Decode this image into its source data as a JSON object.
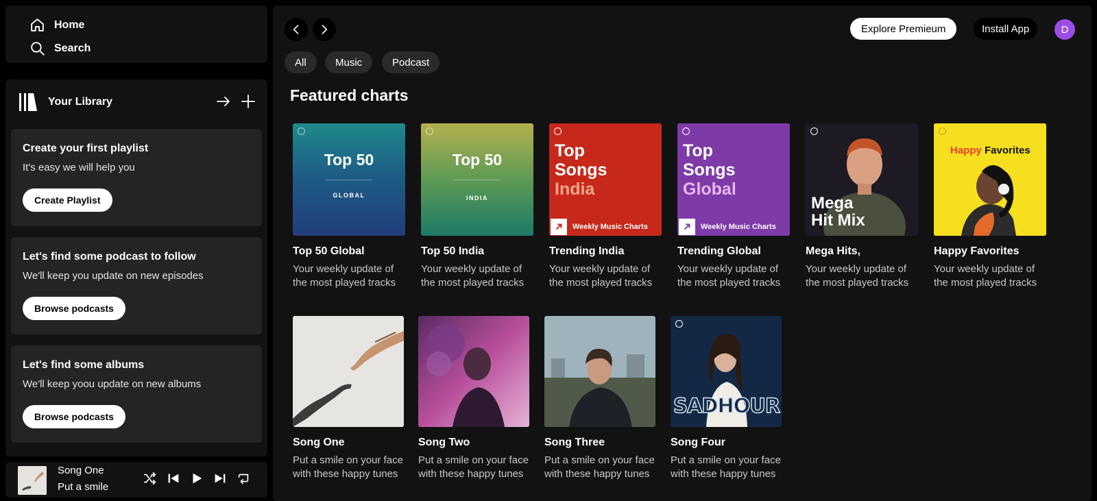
{
  "nav": {
    "home": "Home",
    "search": "Search"
  },
  "library": {
    "title": "Your Library",
    "cards": [
      {
        "title": "Create your first playlist",
        "subtitle": "It's easy we will help you",
        "button": "Create Playlist"
      },
      {
        "title": "Let's find some podcast to follow",
        "subtitle": "We'll keep you update on new episodes",
        "button": "Browse podcasts"
      },
      {
        "title": "Let's find some albums",
        "subtitle": "We'll keep yoou update on new albums",
        "button": "Browse podcasts"
      }
    ]
  },
  "player": {
    "title": "Song One",
    "subtitle": "Put a smile"
  },
  "header": {
    "premium": "Explore Premieum",
    "install": "Install App",
    "avatar": "D"
  },
  "filters": [
    "All",
    "Music",
    "Podcast"
  ],
  "section_title": "Featured charts",
  "charts": [
    {
      "title": "Top 50 Global",
      "subtitle": "Your weekly update of the most played tracks",
      "cover_big": "Top 50",
      "cover_small": "GLOBAL"
    },
    {
      "title": "Top 50 India",
      "subtitle": "Your weekly update of the most played tracks",
      "cover_big": "Top 50",
      "cover_small": "INDIA"
    },
    {
      "title": "Trending India",
      "subtitle": "Your weekly update of the most played tracks",
      "cover_l1": "Top",
      "cover_l2": "Songs",
      "cover_l3": "India",
      "cover_tag": "Weekly Music Charts"
    },
    {
      "title": "Trending Global",
      "subtitle": "Your weekly update of the most played tracks",
      "cover_l1": "Top",
      "cover_l2": "Songs",
      "cover_l3": "Global",
      "cover_tag": "Weekly Music Charts"
    },
    {
      "title": "Mega Hits,",
      "subtitle": "Your weekly update of the most played tracks",
      "cover_l1": "Mega",
      "cover_l2": "Hit Mix"
    },
    {
      "title": "Happy Favorites",
      "subtitle": "Your weekly update of the most played tracks",
      "cover_l1": "Happy",
      "cover_l2": "Favorites"
    }
  ],
  "songs": [
    {
      "title": "Song One",
      "subtitle": "Put a smile on your face with these happy tunes"
    },
    {
      "title": "Song Two",
      "subtitle": "Put a smile on your face with these happy tunes"
    },
    {
      "title": "Song Three",
      "subtitle": "Put a smile on your face with these happy tunes"
    },
    {
      "title": "Song Four",
      "subtitle": "Put a smile on your face with these happy tunes",
      "cover_text": "SADHOUR"
    }
  ]
}
